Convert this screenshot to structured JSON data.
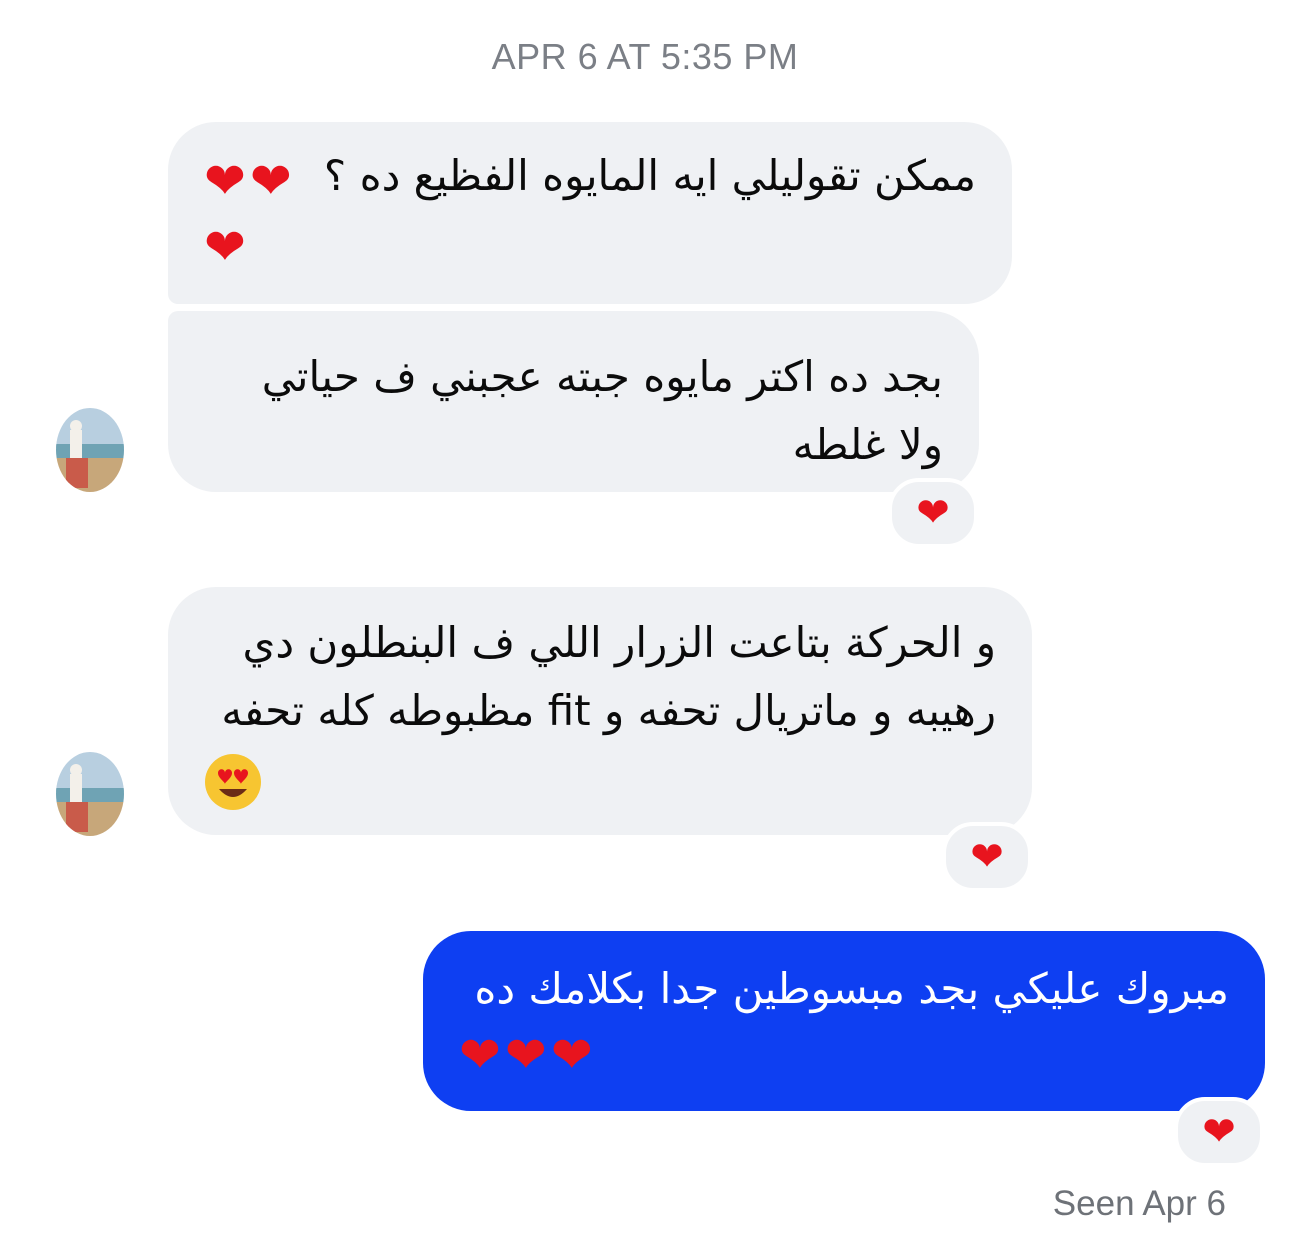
{
  "header": {
    "timestamp": "APR 6 AT 5:35 PM"
  },
  "messages": [
    {
      "direction": "incoming",
      "text": "ممكن تقوليلي ايه المايوه الفظيع ده ؟",
      "hearts": [
        "❤",
        "❤",
        "❤"
      ],
      "reaction": null
    },
    {
      "direction": "incoming",
      "line1": "بجد ده اكتر مايوه جبته عجبني ف حياتي",
      "line2": "ولا غلطه",
      "reaction": "❤"
    },
    {
      "direction": "incoming",
      "line1": "و الحركة بتاعت الزرار اللي ف البنطلون دي",
      "line2": "رهيبه و ماتريال تحفه و fit مظبوطه كله تحفه",
      "emoji": "heart-eyes-emoji",
      "reaction": "❤"
    },
    {
      "direction": "outgoing",
      "text": "مبروك عليكي بجد مبسوطين جدا بكلامك ده",
      "hearts": [
        "❤",
        "❤",
        "❤"
      ],
      "reaction": "❤"
    }
  ],
  "status": {
    "seen": "Seen Apr 6"
  },
  "colors": {
    "incoming_bubble": "#eff1f4",
    "outgoing_bubble": "#0e3ff2",
    "heart": "#e8141e",
    "timestamp_text": "#7b7f86"
  }
}
